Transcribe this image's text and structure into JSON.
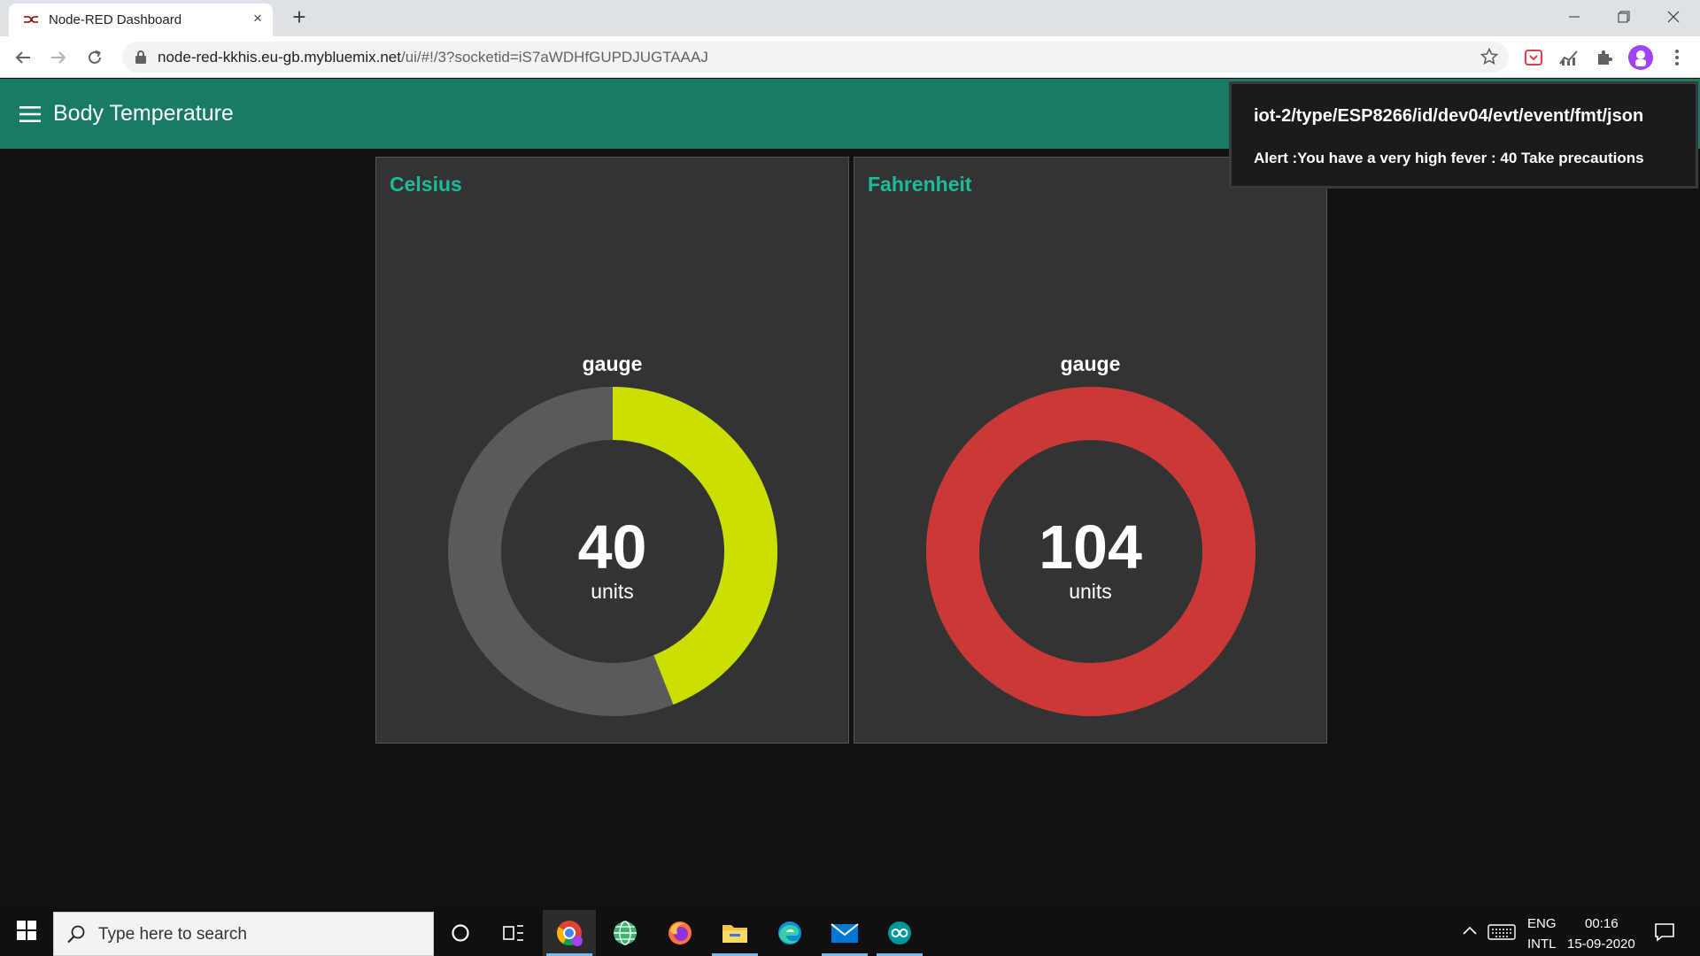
{
  "browser": {
    "tab_title": "Node-RED Dashboard",
    "tab_close": "×",
    "new_tab": "+",
    "url_host": "node-red-kkhis.eu-gb.mybluemix.net",
    "url_path": "/ui/#!/3?socketid=iS7aWDHfGUPDJUGTAAAJ"
  },
  "dashboard": {
    "title": "Body Temperature",
    "accent_color": "#187c64",
    "cards": [
      {
        "title": "Celsius",
        "gauge_label": "gauge",
        "value": "40",
        "units": "units",
        "fill_fraction": 0.44,
        "fill_color": "#cbe000",
        "track_color": "#5a5a5a"
      },
      {
        "title": "Fahrenheit",
        "gauge_label": "gauge",
        "value": "104",
        "units": "units",
        "fill_fraction": 1.0,
        "fill_color": "#ca3838",
        "track_color": "#5a5a5a"
      }
    ]
  },
  "toast": {
    "topic": "iot-2/type/ESP8266/id/dev04/evt/event/fmt/json",
    "message": "Alert :You have a very high fever : 40 Take precautions"
  },
  "taskbar": {
    "search_placeholder": "Type here to search",
    "lang_top": "ENG",
    "lang_bottom": "INTL",
    "time": "00:16",
    "date": "15-09-2020"
  }
}
